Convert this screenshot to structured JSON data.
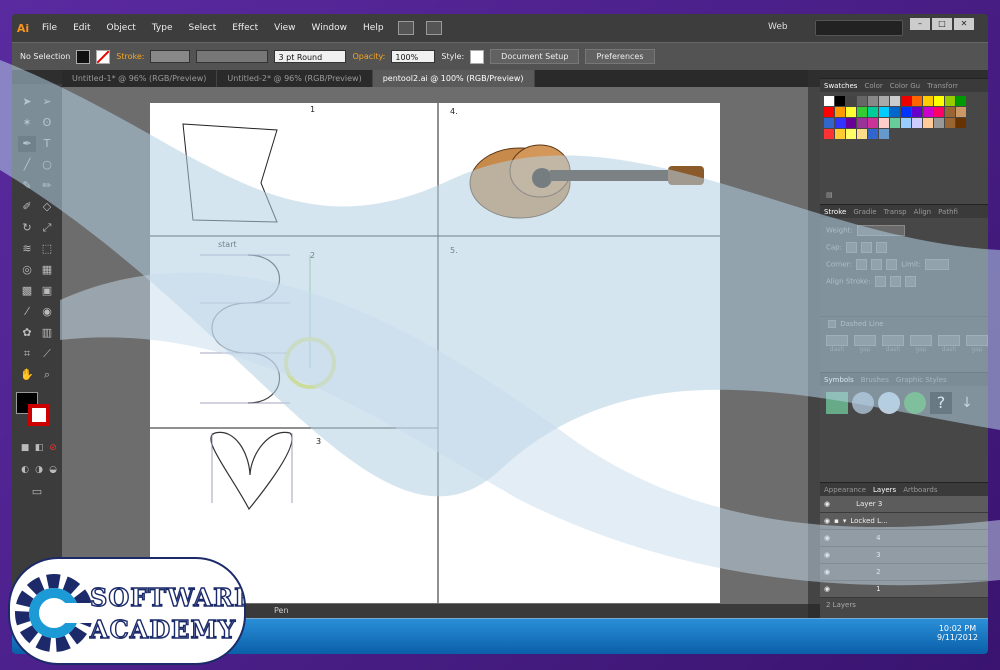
{
  "app": {
    "logo": "Ai",
    "menu": [
      "File",
      "Edit",
      "Object",
      "Type",
      "Select",
      "Effect",
      "View",
      "Window",
      "Help"
    ],
    "workspace": "Web"
  },
  "control_bar": {
    "selection": "No Selection",
    "stroke_label": "Stroke:",
    "brush": "3 pt Round",
    "opacity_label": "Opacity:",
    "opacity": "100%",
    "style_label": "Style:",
    "doc_setup": "Document Setup",
    "preferences": "Preferences"
  },
  "tabs": [
    {
      "label": "Untitled-1* @ 96% (RGB/Preview)"
    },
    {
      "label": "Untitled-2* @ 96% (RGB/Preview)"
    },
    {
      "label": "pentool2.ai @ 100% (RGB/Preview)"
    }
  ],
  "artboard": {
    "labels": [
      "1",
      "start",
      "2",
      "3",
      "4.",
      "5."
    ]
  },
  "status": {
    "tool": "Pen"
  },
  "panels": {
    "top_tabs": [
      "Swatches",
      "Color",
      "Color Gu",
      "Transforr"
    ],
    "stroke_tabs": [
      "Stroke",
      "Gradie",
      "Transp",
      "Align",
      "Pathfi"
    ],
    "weight_label": "Weight:",
    "cap_label": "Cap:",
    "corner_label": "Corner:",
    "limit_label": "Limit:",
    "align_label": "Align Stroke:",
    "dashed": "Dashed Line",
    "dash_labels": [
      "dash",
      "gap",
      "dash",
      "gap",
      "dash",
      "gap"
    ],
    "symbol_tabs": [
      "Symbols",
      "Brushes",
      "Graphic Styles"
    ],
    "layer_tabs": [
      "Appearance",
      "Layers",
      "Artboards"
    ],
    "layers": [
      {
        "name": "Layer 3"
      },
      {
        "name": "Locked L..."
      },
      {
        "name": "4"
      },
      {
        "name": "3"
      },
      {
        "name": "2"
      },
      {
        "name": "1"
      }
    ],
    "layer_count": "2 Layers"
  },
  "taskbar": {
    "time": "10:02 PM",
    "date": "9/11/2012"
  },
  "watermark": {
    "line1": "SOFTWARES",
    "line2": "ACADEMY"
  },
  "colors": {
    "accent": "#f7941e",
    "wave": "#9cc2dc",
    "task": "#1a78c8"
  }
}
